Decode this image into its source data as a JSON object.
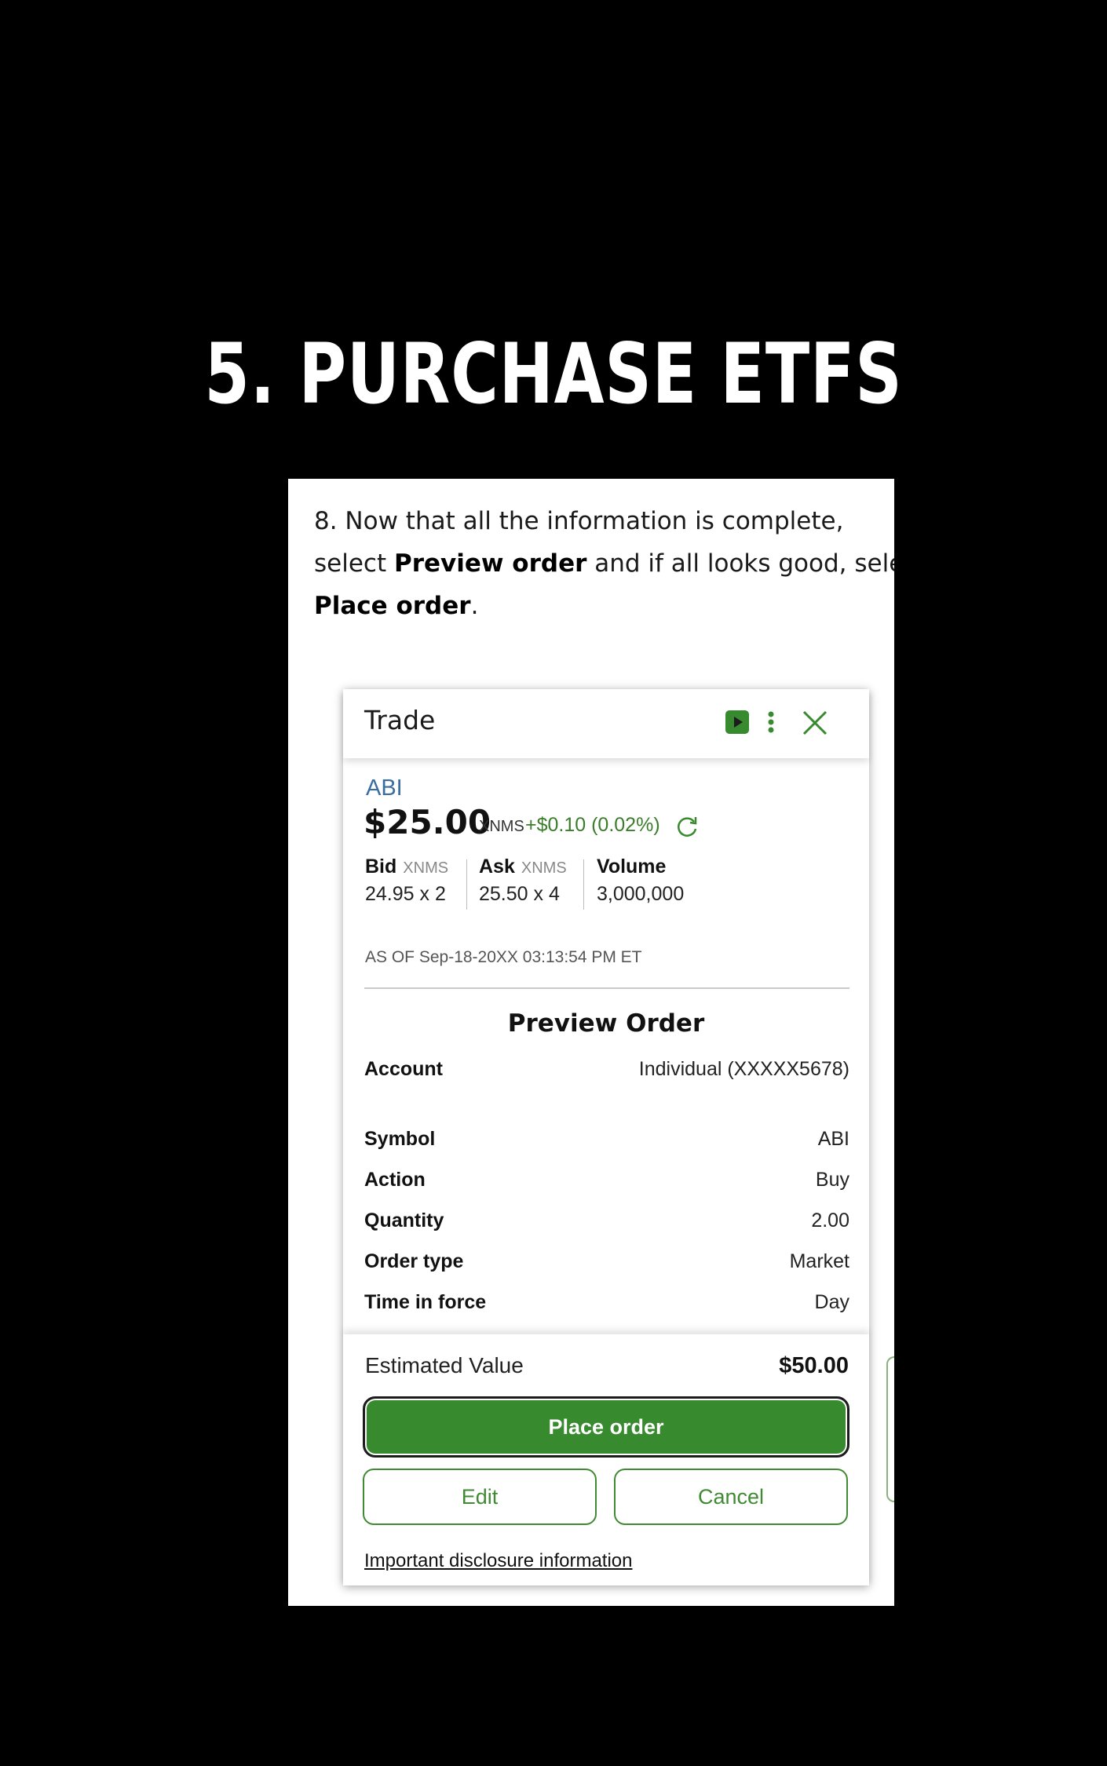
{
  "heading": "5. PURCHASE ETFS",
  "instructions": {
    "part1": "8. Now that all the information is complete,",
    "part2": "select ",
    "bold1": "Preview order",
    "part3": " and if all looks good, select",
    "bold2": "Place order",
    "part4": "."
  },
  "trade": {
    "title": "Trade",
    "icons": {
      "play": "play-icon",
      "menu": "more-vertical-icon",
      "close": "close-icon"
    },
    "symbol": "ABI",
    "price": "$25.00",
    "exchange": "XNMS",
    "change": "+$0.10 (0.02%)",
    "refresh_icon": "refresh-icon",
    "bid": {
      "label": "Bid",
      "exchange": "XNMS",
      "value": "24.95 x 2"
    },
    "ask": {
      "label": "Ask",
      "exchange": "XNMS",
      "value": "25.50 x 4"
    },
    "volume": {
      "label": "Volume",
      "value": "3,000,000"
    },
    "as_of": "AS OF Sep-18-20XX 03:13:54 PM ET"
  },
  "preview": {
    "title": "Preview Order",
    "rows": [
      {
        "label": "Account",
        "value": "Individual (XXXXX5678)"
      },
      {
        "label": "Symbol",
        "value": "ABI"
      },
      {
        "label": "Action",
        "value": "Buy"
      },
      {
        "label": "Quantity",
        "value": "2.00"
      },
      {
        "label": "Order type",
        "value": "Market"
      },
      {
        "label": "Time in force",
        "value": "Day"
      }
    ]
  },
  "footer": {
    "estimated_label": "Estimated Value",
    "estimated_value": "$50.00",
    "place_order": "Place order",
    "edit": "Edit",
    "cancel": "Cancel",
    "disclosure": "Important disclosure information"
  },
  "colors": {
    "accent_green": "#388a2f",
    "link_blue": "#3a6da0",
    "background": "#000000"
  }
}
